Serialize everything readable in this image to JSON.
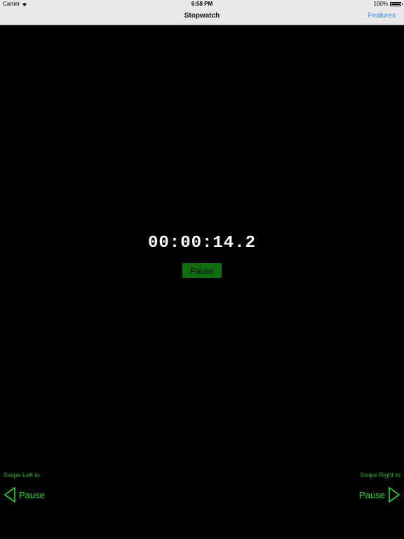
{
  "status_bar": {
    "carrier": "Carrier",
    "time": "6:58 PM",
    "battery": "100%"
  },
  "nav": {
    "title": "Stopwatch",
    "features": "Features"
  },
  "timer": {
    "display": "00:00:14.2",
    "button": "Pause"
  },
  "swipe_left": {
    "hint": "Swipe Left to",
    "action": "Pause"
  },
  "swipe_right": {
    "hint": "Swipe Right to",
    "action": "Pause"
  },
  "colors": {
    "background": "#000000",
    "nav_bg": "#e9e9e9",
    "link": "#2a8cf5",
    "button_green": "#0f6e0f",
    "swipe_green": "#1fe01f"
  }
}
